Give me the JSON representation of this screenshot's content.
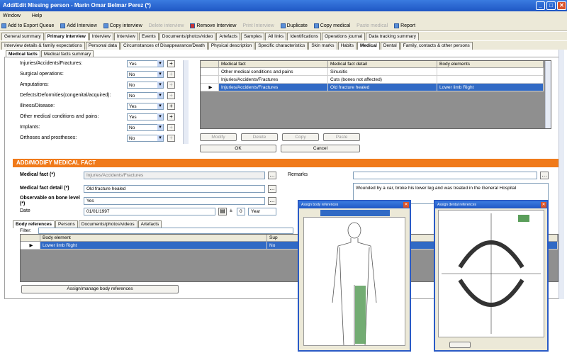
{
  "window": {
    "title": "Add/Edit Missing person - Marin Omar Belmar Perez (*)"
  },
  "menu": [
    "Window",
    "Help"
  ],
  "toolbar": [
    "Add to Export Queue",
    "Add Interview",
    "Copy interview",
    "Delete interview",
    "Remove Interview",
    "Print Interview",
    "Duplicate",
    "Copy medical",
    "Paste medical",
    "Report"
  ],
  "main_tabs": [
    "General summary",
    "Primary interview",
    "Interview",
    "Interview",
    "Events",
    "Documents/photos/video",
    "Artefacts",
    "Samples",
    "All links",
    "Identifications",
    "Operations journal",
    "Data tracking summary"
  ],
  "sub_tabs": [
    "Interview details & family expectations",
    "Personal data",
    "Circumstances of Disappearance/Death",
    "Physical description",
    "Specific characteristics",
    "Skin marks",
    "Habits",
    "Medical",
    "Dental",
    "Family, contacts & other persons"
  ],
  "medical_tabs": [
    "Medical facts",
    "Medical facts summary"
  ],
  "medical_questions": [
    {
      "label": "Injuries/Accidents/Fractures:",
      "value": "Yes"
    },
    {
      "label": "Surgical operations:",
      "value": "No"
    },
    {
      "label": "Amputations:",
      "value": "No"
    },
    {
      "label": "Defects/Deformities(congenital/acquired):",
      "value": "No"
    },
    {
      "label": "Illness/Disease:",
      "value": "Yes"
    },
    {
      "label": "Other medical conditions and pains:",
      "value": "Yes"
    },
    {
      "label": "Implants:",
      "value": "No"
    },
    {
      "label": "Orthoses and prostheses:",
      "value": "No"
    }
  ],
  "facts_grid": {
    "headers": [
      "Medical fact",
      "Medical fact detail",
      "Body elements"
    ],
    "rows": [
      [
        "Other medical conditions and pains",
        "Sinusitis",
        ""
      ],
      [
        "Injuries/Accidents/Fractures",
        "Cuts (bones not affected)",
        ""
      ],
      [
        "Injuries/Accidents/Fractures",
        "Old fracture healed",
        "Lower limb Right"
      ]
    ]
  },
  "grid_buttons": {
    "modify": "Modify",
    "delete": "Delete",
    "copy": "Copy",
    "paste": "Paste",
    "ok": "OK",
    "cancel": "Cancel"
  },
  "form": {
    "section_title": "ADD/MODIFY MEDICAL FACT",
    "medical_fact_label": "Medical fact (*)",
    "medical_fact_value": "Injuries/Accidents/Fractures",
    "detail_label": "Medical fact detail (*)",
    "detail_value": "Old fracture healed",
    "observable_label": "Observable on bone level (*)",
    "observable_value": "Yes",
    "date_label": "Date",
    "date_value": "01/01/1997",
    "plus_minus": "±",
    "date_offset": "0",
    "date_unit": "Year",
    "remarks_label": "Remarks",
    "remarks_text": "Wounded by a car, broke his lower leg and was treated in the General Hospital"
  },
  "bottom_tabs": [
    "Body references",
    "Persons",
    "Documents/photos/videos",
    "Artefacts"
  ],
  "body_grid": {
    "filter_label": "Filter:",
    "headers": [
      "Body element",
      "Sup"
    ],
    "row": [
      "Lower limb Right",
      "No"
    ]
  },
  "assign_button": "Assign/manage body references",
  "popups": {
    "body_title": "Assign body references",
    "dental_title": "Assign dental references"
  },
  "colors": {
    "accent": "#f07a1a",
    "selection": "#316ac5",
    "highlight": "#5a9e5a"
  }
}
